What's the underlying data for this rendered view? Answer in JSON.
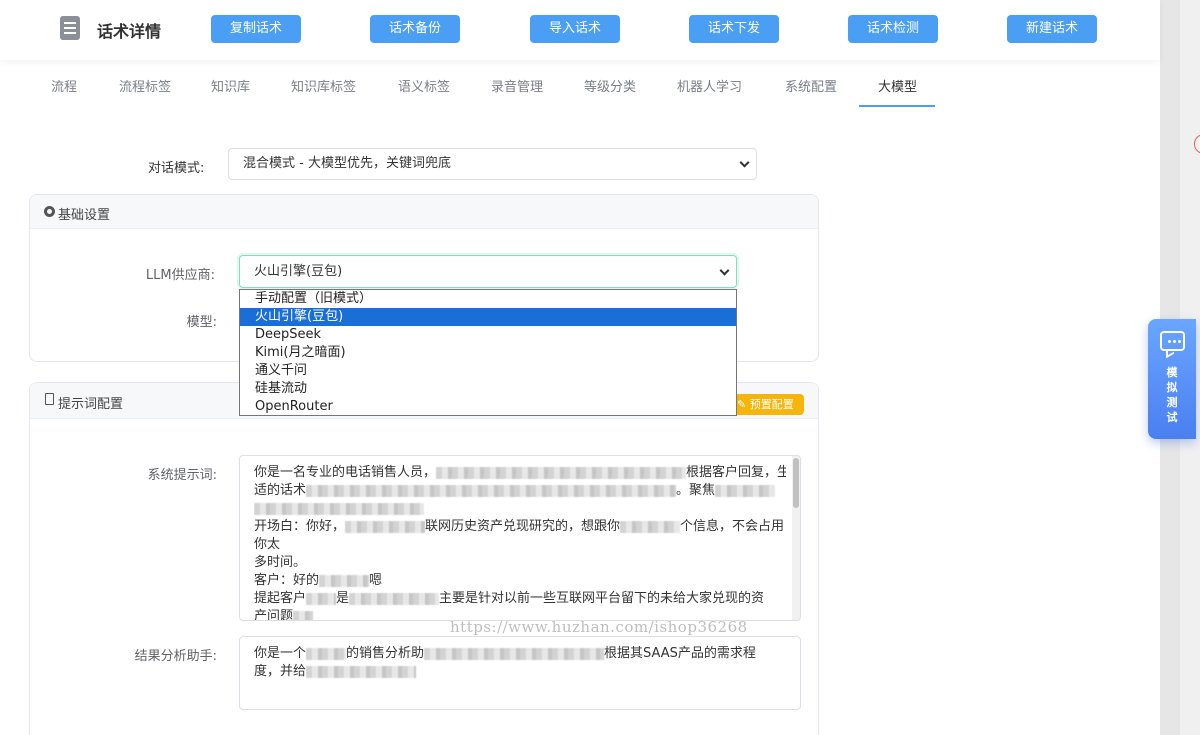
{
  "header": {
    "title": "话术详情",
    "buttons": [
      "复制话术",
      "话术备份",
      "导入话术",
      "话术下发",
      "话术检测",
      "新建话术"
    ]
  },
  "tabs": [
    "流程",
    "流程标签",
    "知识库",
    "知识库标签",
    "语义标签",
    "录音管理",
    "等级分类",
    "机器人学习",
    "系统配置",
    "大模型"
  ],
  "active_tab": "大模型",
  "dialog_mode": {
    "label": "对话模式:",
    "value": "混合模式 - 大模型优先，关键词兜底"
  },
  "basic_settings": {
    "title": "基础设置",
    "llm_label": "LLM供应商:",
    "llm_value": "火山引擎(豆包)",
    "model_label": "模型:",
    "options": [
      "手动配置（旧模式）",
      "火山引擎(豆包)",
      "DeepSeek",
      "Kimi(月之暗面)",
      "通义千问",
      "硅基流动",
      "OpenRouter"
    ],
    "selected_index": 1
  },
  "prompt_config": {
    "title": "提示词配置",
    "preset_button": "预置配置",
    "system_label": "系统提示词:",
    "system_lines": [
      {
        "a": "你是一名专业的电话销售人员，",
        "b": "",
        "c": "根据客户回复，生成"
      },
      {
        "a": "适的话术",
        "b": "",
        "c": "。聚焦"
      },
      {
        "a": "",
        "b": "",
        "c": ""
      },
      {
        "a": "开场白：你好，",
        "b": "",
        "c": "联网历史资产兑现研究的，想跟你",
        "d": "个信息，不会占用"
      },
      {
        "a": "你太",
        "b": "",
        "c": ""
      },
      {
        "a": "多时间。",
        "b": "",
        "c": ""
      },
      {
        "a": "客户：好的",
        "b": "",
        "c": "嗯"
      },
      {
        "a": "提起客户",
        "b": "",
        "c": "是",
        "d": "主要是针对以前一些互联网平台留下的未给大家兑现的资"
      },
      {
        "a": "产问题",
        "b": "",
        "c": ""
      }
    ],
    "analysis_label": "结果分析助手:",
    "analysis_lines": [
      {
        "a": "你是一个",
        "b": "",
        "c": "的销售分析助",
        "d": "根据其SAAS产品的需求程"
      },
      {
        "a": "度，并给",
        "b": "",
        "c": ""
      }
    ]
  },
  "watermark": "https://www.huzhan.com/ishop36268",
  "float_button": {
    "label": "模拟测试"
  },
  "colors": {
    "primary": "#4a9ff5",
    "preset": "#f5b50b",
    "selected": "#1a6fd6"
  }
}
